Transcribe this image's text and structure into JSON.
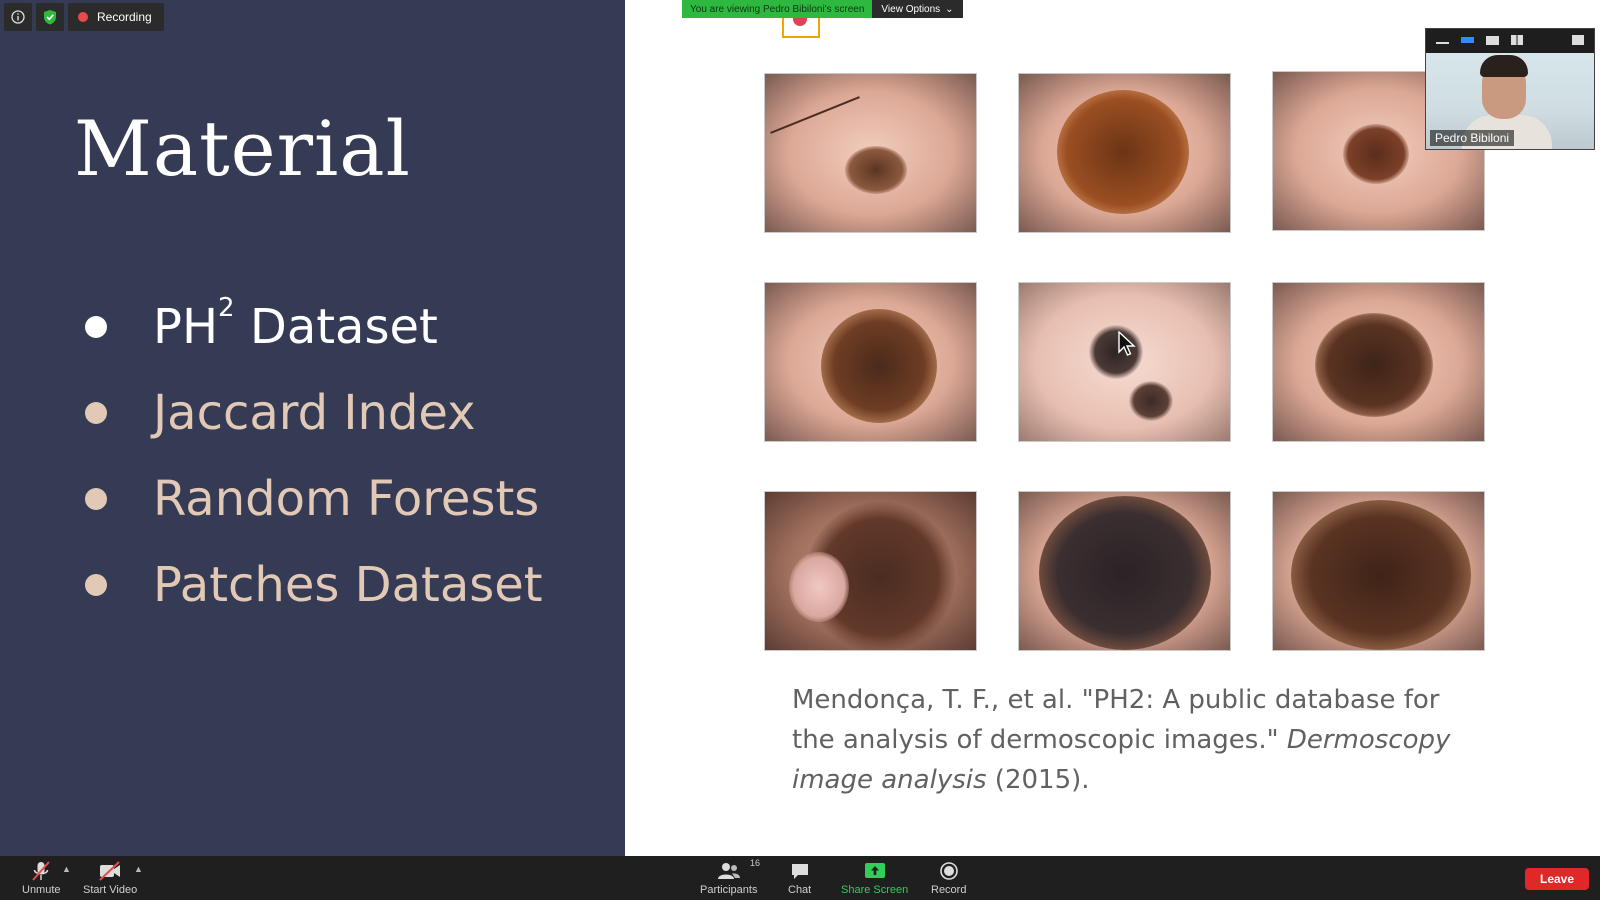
{
  "top_bar": {
    "recording_label": "Recording",
    "viewing_banner": "You are viewing Pedro Bibiloni's screen",
    "view_options_label": "View Options"
  },
  "slide": {
    "title": "Material",
    "bullets": [
      {
        "text": "PH",
        "sup": "2",
        "suffix": " Dataset",
        "active": true
      },
      {
        "text": "Jaccard Index",
        "active": false
      },
      {
        "text": "Random Forests",
        "active": false
      },
      {
        "text": "Patches Dataset",
        "active": false
      }
    ],
    "citation": {
      "line_a": "Mendonça, T. F., et al. \"PH2: A public database for the analysis of dermoscopic images.\" ",
      "journal": "Dermoscopy image analysis",
      "year": " (2015)."
    }
  },
  "video": {
    "participant_name": "Pedro Bibiloni"
  },
  "toolbar": {
    "unmute_label": "Unmute",
    "start_video_label": "Start Video",
    "participants_label": "Participants",
    "participants_count": "16",
    "chat_label": "Chat",
    "share_screen_label": "Share Screen",
    "record_label": "Record",
    "leave_label": "Leave"
  },
  "colors": {
    "slide_left_bg": "#353a55",
    "bullet_inactive": "#e2c9b6",
    "share_green": "#2fd05a",
    "leave_red": "#e02828",
    "banner_green": "#2fb840"
  }
}
